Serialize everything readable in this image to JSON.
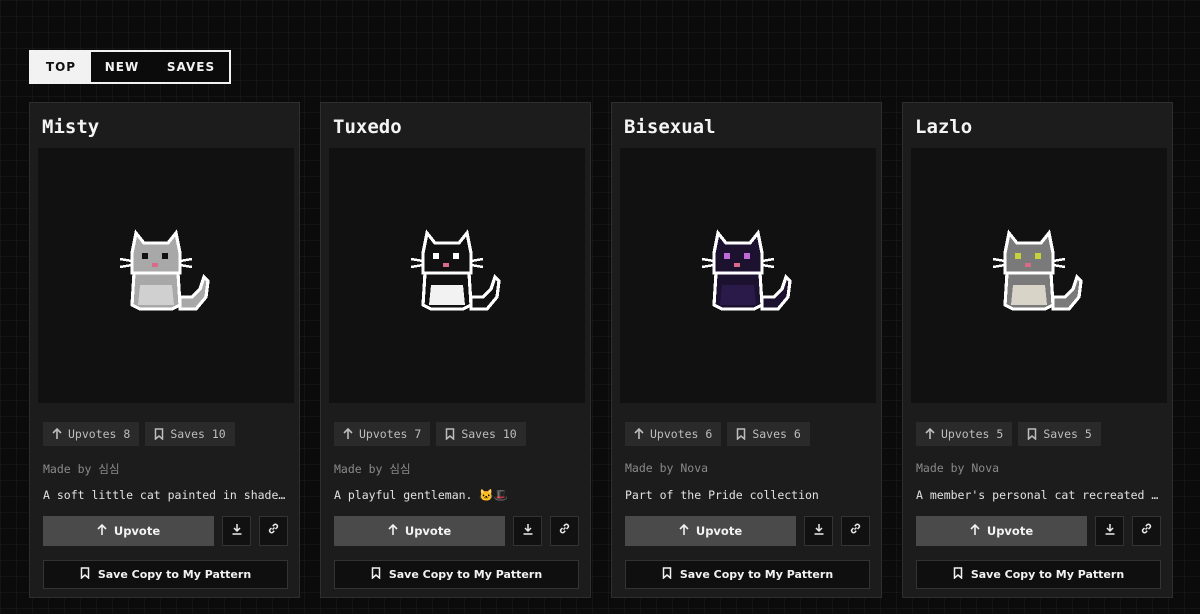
{
  "tabs": [
    "TOP",
    "NEW",
    "SAVES"
  ],
  "active_tab": "TOP",
  "cards": [
    {
      "title": "Misty",
      "upvotes_label": "Upvotes 8",
      "saves_label": "Saves 10",
      "made_by": "Made by 심심",
      "description": "A soft little cat painted in shades of grey",
      "upvote_label": "Upvote",
      "save_copy_label": "Save Copy to My Pattern",
      "cat": {
        "body": "#a8a8a8",
        "belly": "#d0d0d0",
        "outline": "#ffffff",
        "eye": "#111111"
      }
    },
    {
      "title": "Tuxedo",
      "upvotes_label": "Upvotes 7",
      "saves_label": "Saves 10",
      "made_by": "Made by 심심",
      "description": "A playful gentleman. 🐱🎩",
      "upvote_label": "Upvote",
      "save_copy_label": "Save Copy to My Pattern",
      "cat": {
        "body": "#111111",
        "belly": "#f2f2f2",
        "outline": "#ffffff",
        "eye": "#ffffff"
      }
    },
    {
      "title": "Bisexual",
      "upvotes_label": "Upvotes 6",
      "saves_label": "Saves 6",
      "made_by": "Made by Nova",
      "description": "Part of the Pride collection",
      "upvote_label": "Upvote",
      "save_copy_label": "Save Copy to My Pattern",
      "cat": {
        "body": "#1c1230",
        "belly": "#2a1a4a",
        "outline": "#ffffff",
        "eye": "#c06ad8"
      }
    },
    {
      "title": "Lazlo",
      "upvotes_label": "Upvotes 5",
      "saves_label": "Saves 5",
      "made_by": "Made by Nova",
      "description": "A member's personal cat recreated in pixels",
      "upvote_label": "Upvote",
      "save_copy_label": "Save Copy to My Pattern",
      "cat": {
        "body": "#7a7a7a",
        "belly": "#d8d4c8",
        "outline": "#ffffff",
        "eye": "#c8d23a"
      }
    }
  ]
}
